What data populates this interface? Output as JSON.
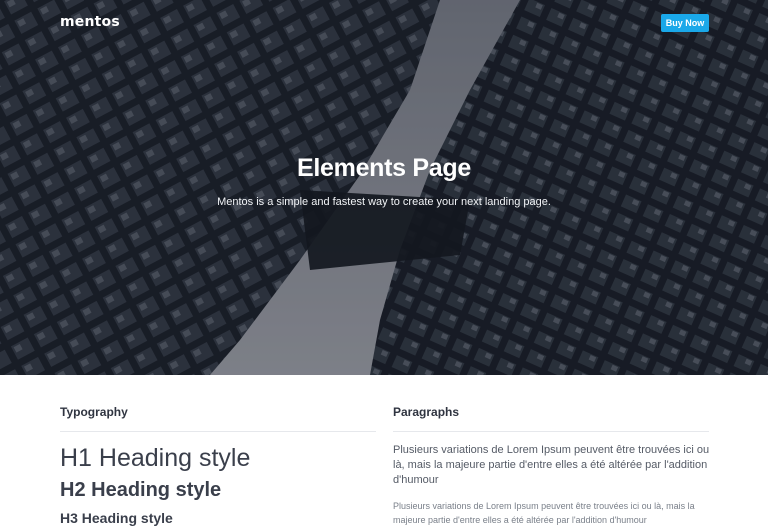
{
  "nav": {
    "logo": "mentos",
    "buy_label": "Buy Now"
  },
  "hero": {
    "title": "Elements Page",
    "subtitle": "Mentos is a simple and fastest way to create your next landing page."
  },
  "typography": {
    "title": "Typography",
    "h1": "H1 Heading style",
    "h2": "H2 Heading style",
    "h3": "H3 Heading style"
  },
  "paragraphs": {
    "title": "Paragraphs",
    "lead": "Plusieurs variations de Lorem Ipsum peuvent être trouvées ici ou là, mais la majeure partie d'entre elles a été altérée par l'addition d'humour",
    "body": "Plusieurs variations de Lorem Ipsum peuvent être trouvées ici ou là, mais la majeure partie d'entre elles a été altérée par l'addition d'humour"
  },
  "colors": {
    "accent": "#1aa8e9"
  }
}
